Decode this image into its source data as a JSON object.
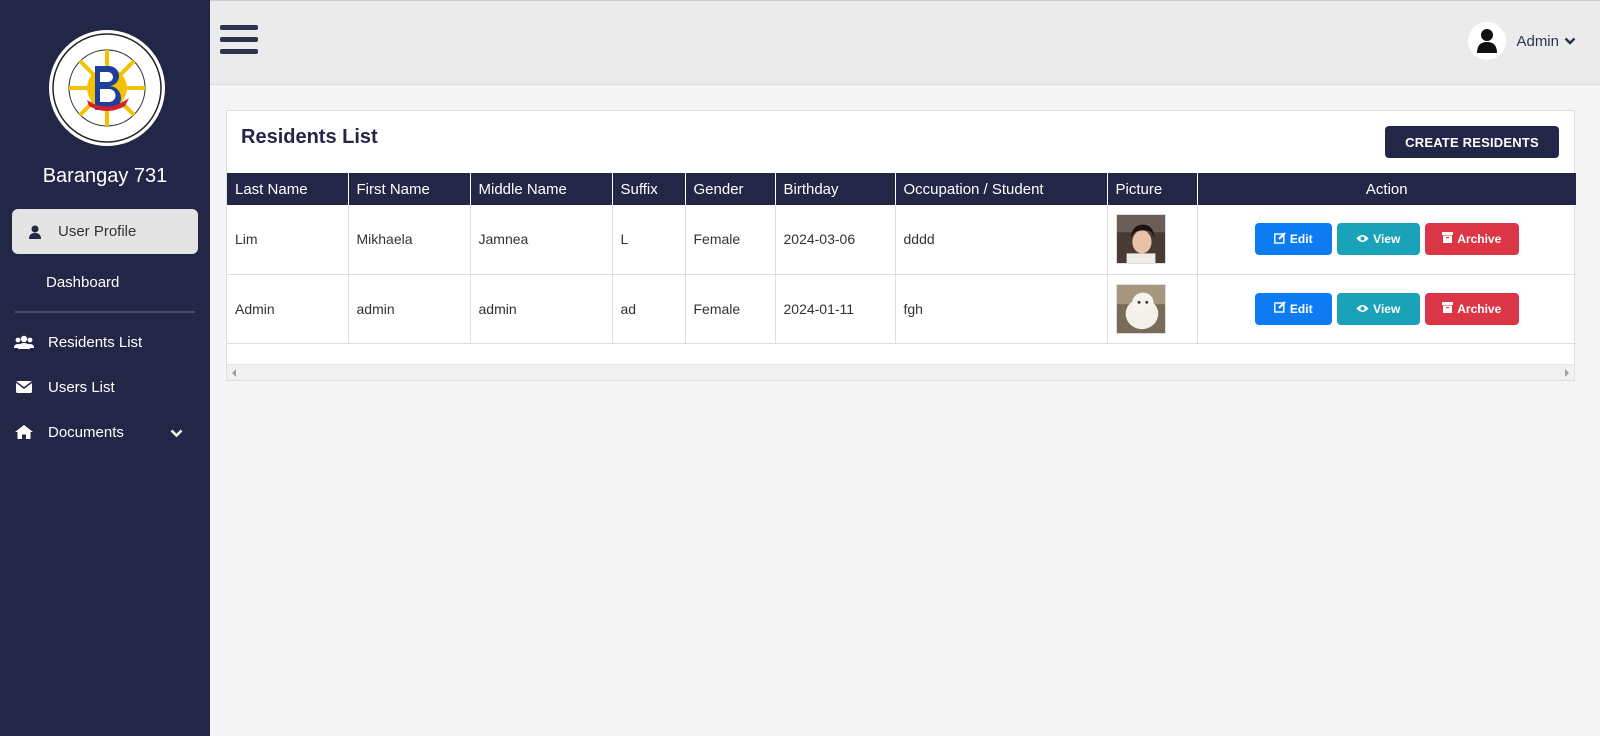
{
  "sidebar": {
    "brand_name": "Barangay 731",
    "logo_text": [
      "DISTRICT 5",
      "BARANGAY 731",
      "ZONE 80",
      "LUNGSOD NG MAYNILA"
    ],
    "profile_label": "User Profile",
    "dashboard_label": "Dashboard",
    "items": [
      {
        "label": "Residents List",
        "icon": "users-icon"
      },
      {
        "label": "Users List",
        "icon": "envelope-icon"
      },
      {
        "label": "Documents",
        "icon": "home-icon"
      }
    ]
  },
  "header": {
    "user_name": "Admin"
  },
  "card": {
    "title": "Residents List",
    "create_label": "CREATE RESIDENTS"
  },
  "table": {
    "columns": [
      "Last Name",
      "First Name",
      "Middle Name",
      "Suffix",
      "Gender",
      "Birthday",
      "Occupation / Student",
      "Picture",
      "Action"
    ],
    "rows": [
      {
        "last": "Lim",
        "first": "Mikhaela",
        "middle": "Jamnea",
        "suffix": "L",
        "gender": "Female",
        "birthday": "2024-03-06",
        "occupation": "dddd"
      },
      {
        "last": "Admin",
        "first": "admin",
        "middle": "admin",
        "suffix": "ad",
        "gender": "Female",
        "birthday": "2024-01-11",
        "occupation": "fgh"
      }
    ],
    "actions": {
      "edit": "Edit",
      "view": "View",
      "archive": "Archive"
    }
  },
  "colors": {
    "sidebar": "#232646",
    "edit": "#0d7cf2",
    "view": "#1aa2b8",
    "archive": "#dc3545"
  }
}
